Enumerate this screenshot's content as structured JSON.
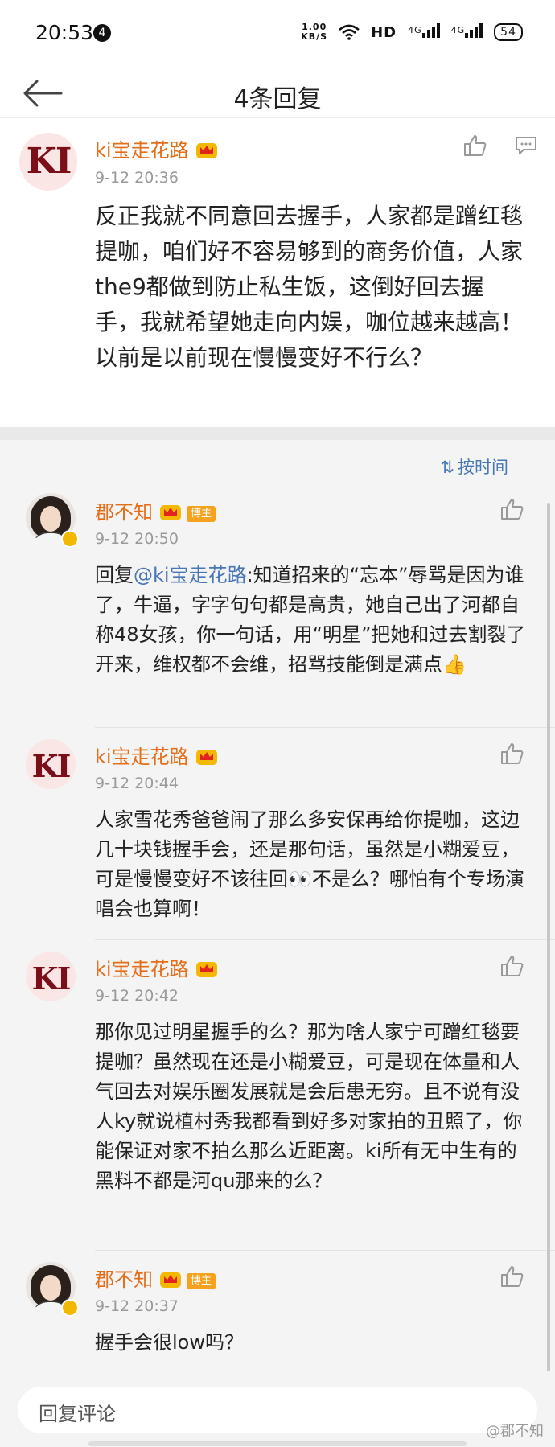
{
  "status": {
    "time": "20:53",
    "notif": "4",
    "speed": "1.00",
    "speed_unit": "KB/S",
    "hd": "HD",
    "net1": "4G",
    "net2": "4G",
    "battery": "54"
  },
  "nav": {
    "title": "4条回复"
  },
  "original": {
    "name": "ki宝走花路",
    "date": "9-12 20:36",
    "avatar_text": "KI",
    "text": "反正我就不同意回去握手，人家都是蹭红毯提咖，咱们好不容易够到的商务价值，人家the9都做到防止私生饭，这倒好回去握手，我就希望她走向内娱，咖位越来越高！以前是以前现在慢慢变好不行么？"
  },
  "sort": {
    "label": "按时间"
  },
  "comments": [
    {
      "name": "郡不知",
      "tag": "博主",
      "date": "9-12 20:50",
      "reply_prefix": "回复",
      "at": "@ki宝走花路",
      "text": ":知道招来的“忘本”辱骂是因为谁了，牛逼，字字句句都是高贵，她自己出了河都自称48女孩，你一句话，用“明星”把她和过去割裂了开来，维权都不会维，招骂技能倒是满点👍"
    },
    {
      "name": "ki宝走花路",
      "avatar_text": "KI",
      "date": "9-12 20:44",
      "text": "人家雪花秀爸爸闹了那么多安保再给你提咖，这边几十块钱握手会，还是那句话，虽然是小糊爱豆，可是慢慢变好不该往回👀不是么？哪怕有个专场演唱会也算啊！"
    },
    {
      "name": "ki宝走花路",
      "avatar_text": "KI",
      "date": "9-12 20:42",
      "text": "那你见过明星握手的么？那为啥人家宁可蹭红毯要提咖？虽然现在还是小糊爱豆，可是现在体量和人气回去对娱乐圈发展就是会后患无穷。且不说有没人ky就说植村秀我都看到好多对家拍的丑照了，你能保证对家不拍么那么近距离。ki所有无中生有的黑料不都是河qu那来的么？"
    },
    {
      "name": "郡不知",
      "tag": "博主",
      "date": "9-12 20:37",
      "text": "握手会很low吗？"
    }
  ],
  "bottom": {
    "placeholder": "回复评论",
    "watermark": "@郡不知"
  },
  "colors": {
    "name": "#e46e1a",
    "link": "#4876b6",
    "crown": "#f5b800",
    "tag": "#f6a21e"
  }
}
